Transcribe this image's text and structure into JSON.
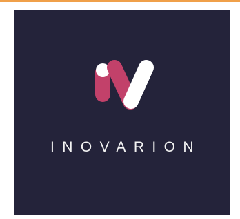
{
  "logo": {
    "wordmark": "INOVARION",
    "icon": "iv-monogram-icon",
    "colors": {
      "background": "#24233a",
      "accent_primary": "#c2416a",
      "accent_secondary": "#ffffff",
      "text": "#f3f3f3",
      "top_border": "#f0a04a"
    }
  }
}
